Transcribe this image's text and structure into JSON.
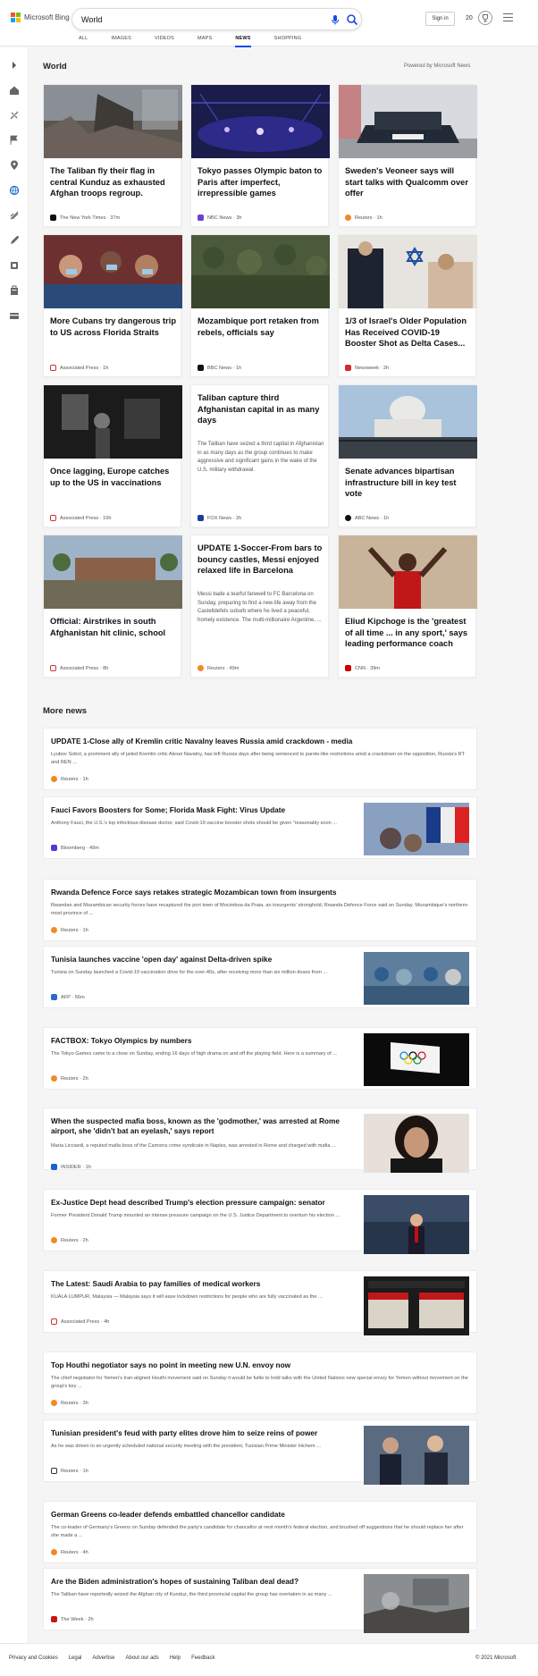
{
  "header": {
    "logo_text": "Microsoft Bing",
    "search_value": "World",
    "sign_in": "Sign in",
    "rewards_count": "20",
    "tabs": [
      {
        "label": "ALL"
      },
      {
        "label": "IMAGES"
      },
      {
        "label": "VIDEOS"
      },
      {
        "label": "MAPS"
      },
      {
        "label": "NEWS"
      },
      {
        "label": "SHOPPING"
      }
    ],
    "active_tab": "NEWS"
  },
  "sidebar": {
    "icons": [
      "chevron-right-icon",
      "home-icon",
      "sports-icon",
      "flag-icon",
      "location-icon",
      "globe-icon",
      "science-icon",
      "rocket-icon",
      "entertainment-icon",
      "business-icon",
      "money-icon"
    ]
  },
  "section": {
    "title": "World",
    "powered_by": "Powered by Microsoft News"
  },
  "cards": [
    {
      "title": "The Taliban fly their flag in central Kunduz as exhausted Afghan troops regroup.",
      "source": "The New York Times · 37m"
    },
    {
      "title": "Tokyo passes Olympic baton to Paris after imperfect, irrepressible games",
      "source": "NBC News · 3h"
    },
    {
      "title": "Sweden's Veoneer says will start talks with Qualcomm over offer",
      "source": "Reuters · 1h"
    },
    {
      "title": "More Cubans try dangerous trip to US across Florida Straits",
      "source": "Associated Press · 1h"
    },
    {
      "title": "Mozambique port retaken from rebels, officials say",
      "source": "BBC News · 1h"
    },
    {
      "title": "1/3 of Israel's Older Population Has Received COVID-19 Booster Shot as Delta Cases...",
      "source": "Newsweek · 2h"
    },
    {
      "title": "Once lagging, Europe catches up to the US in vaccinations",
      "source": "Associated Press · 10h"
    },
    {
      "title": "Taliban capture third Afghanistan capital in as many days",
      "desc": "The Taliban have seized a third capital in Afghanistan in as many days as the group continues to make aggressive and significant gains in the wake of the U.S. military withdrawal.",
      "source": "FOX News · 2h"
    },
    {
      "title": "Senate advances bipartisan infrastructure bill in key test vote",
      "source": "ABC News · 1h"
    },
    {
      "title": "Official: Airstrikes in south Afghanistan hit clinic, school",
      "source": "Associated Press · 8h"
    },
    {
      "title": "UPDATE 1-Soccer-From bars to bouncy castles, Messi enjoyed relaxed life in Barcelona",
      "desc": "Messi bade a tearful farewell to FC Barcelona on Sunday, preparing to find a new life away from the Castelldefels suburb where he lived a peaceful, homely existence. The multi-millionaire Argentine, ...",
      "source": "Reuters · 49m"
    },
    {
      "title": "Eliud Kipchoge is the 'greatest of all time ... in any sport,' says leading performance coach",
      "source": "CNN · 39m"
    }
  ],
  "more_news": {
    "title": "More news",
    "items": [
      {
        "title": "UPDATE 1-Close ally of Kremlin critic Navalny leaves Russia amid crackdown - media",
        "desc": "Lyubov Sobol, a prominent ally of jailed Kremlin critic Alexei Navalny, has left Russia days after being sentenced to parole-like restrictions amid a crackdown on the opposition, Russia's RT and REN ...",
        "source": "Reuters · 1h"
      },
      {
        "title": "Fauci Favors Boosters for Some; Florida Mask Fight: Virus Update",
        "desc": "Anthony Fauci, the U.S.'s top infectious-disease doctor, said Covid-19 vaccine booster shots should be given \"reasonably soon ...",
        "source": "Bloomberg · 49m"
      },
      {
        "title": "Rwanda Defence Force says retakes strategic Mozambican town from insurgents",
        "desc": "Rwandan and Mozambican security forces have recaptured the port town of Mocimboa da Praia, an insurgents' stronghold, Rwanda Defence Force said on Sunday. Mozambique's northern-most province of ...",
        "source": "Reuters · 1h"
      },
      {
        "title": "Tunisia launches vaccine 'open day' against Delta-driven spike",
        "desc": "Tunisia on Sunday launched a Covid-19 vaccination drive for the over-40s, after receiving more than six million doses from ...",
        "source": "AFP · 56m"
      },
      {
        "title": "FACTBOX: Tokyo Olympics by numbers",
        "desc": "The Tokyo Games came to a close on Sunday, ending 16 days of high drama on and off the playing field. Here is a summary of ...",
        "source": "Reuters · 2h"
      },
      {
        "title": "When the suspected mafia boss, known as the 'godmother,' was arrested at Rome airport, she 'didn't bat an eyelash,' says report",
        "desc": "Maria Licciardi, a reputed mafia boss of the Camorra crime syndicate in Naples, was arrested in Rome and charged with mafia ...",
        "source": "INSIDER · 1h"
      },
      {
        "title": "Ex-Justice Dept head described Trump's election pressure campaign: senator",
        "desc": "Former President Donald Trump mounted an intense pressure campaign on the U.S. Justice Department to overturn his election ...",
        "source": "Reuters · 2h"
      },
      {
        "title": "The Latest: Saudi Arabia to pay families of medical workers",
        "desc": "KUALA LUMPUR, Malaysia — Malaysia says it will ease lockdown restrictions for people who are fully vaccinated as the ...",
        "source": "Associated Press · 4h"
      },
      {
        "title": "Top Houthi negotiator says no point in meeting new U.N. envoy now",
        "desc": "The chief negotiator for Yemen's Iran-aligned Houthi movement said on Sunday it would be futile to hold talks with the United Nations new special envoy for Yemen without movement on the group's key ...",
        "source": "Reuters · 3h"
      },
      {
        "title": "Tunisian president's feud with party elites drove him to seize reins of power",
        "desc": "As he was driven to an urgently scheduled national security meeting with the president, Tunisian Prime Minister Hichem ...",
        "source": "Reuters · 1h"
      },
      {
        "title": "German Greens co-leader defends embattled chancellor candidate",
        "desc": "The co-leader of Germany's Greens on Sunday defended the party's candidate for chancellor at next month's federal election, and brushed off suggestions that he should replace her after she made a ...",
        "source": "Reuters · 4h"
      },
      {
        "title": "Are the Biden administration's hopes of sustaining Taliban deal dead?",
        "desc": "The Taliban have reportedly seized the Afghan city of Kunduz, the third provincial capital the group has overtaken in as many ...",
        "source": "The Week · 2h"
      }
    ]
  },
  "footer": {
    "links": [
      "Privacy and Cookies",
      "Legal",
      "Advertise",
      "About our ads",
      "Help",
      "Feedback"
    ],
    "copyright": "© 2021 Microsoft"
  },
  "colors": {
    "accent": "#174ae4",
    "brand_red": "#f35325",
    "brand_green": "#81bc06",
    "brand_blue": "#05a6f0",
    "brand_yellow": "#ffba08"
  }
}
